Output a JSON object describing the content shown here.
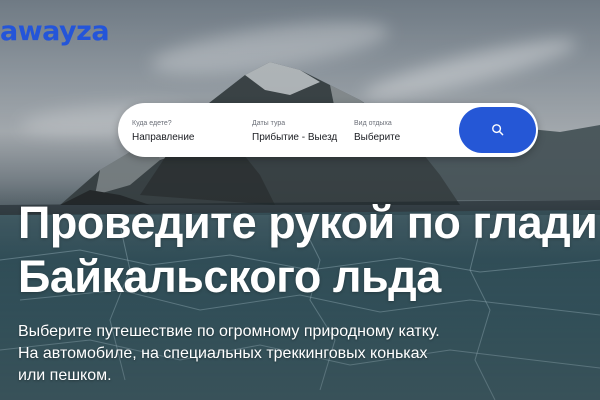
{
  "brand": {
    "logo_text": "awayza",
    "color": "#2455d9"
  },
  "search": {
    "destination": {
      "label": "Куда едете?",
      "value": "Направление"
    },
    "dates": {
      "label": "Даты тура",
      "value": "Прибытие - Выезд"
    },
    "type": {
      "label": "Вид отдыха",
      "value": "Выберите"
    },
    "button_icon": "search-icon",
    "accent_color": "#2557d6"
  },
  "hero": {
    "headline_line1": "Проведите рукой по глади",
    "headline_line2": "Байкальского льда",
    "subtitle_line1": "Выберите путешествие по огромному природному катку.",
    "subtitle_line2": "На автомобиле, на специальных треккинговых коньках",
    "subtitle_line3": "или пешком."
  }
}
